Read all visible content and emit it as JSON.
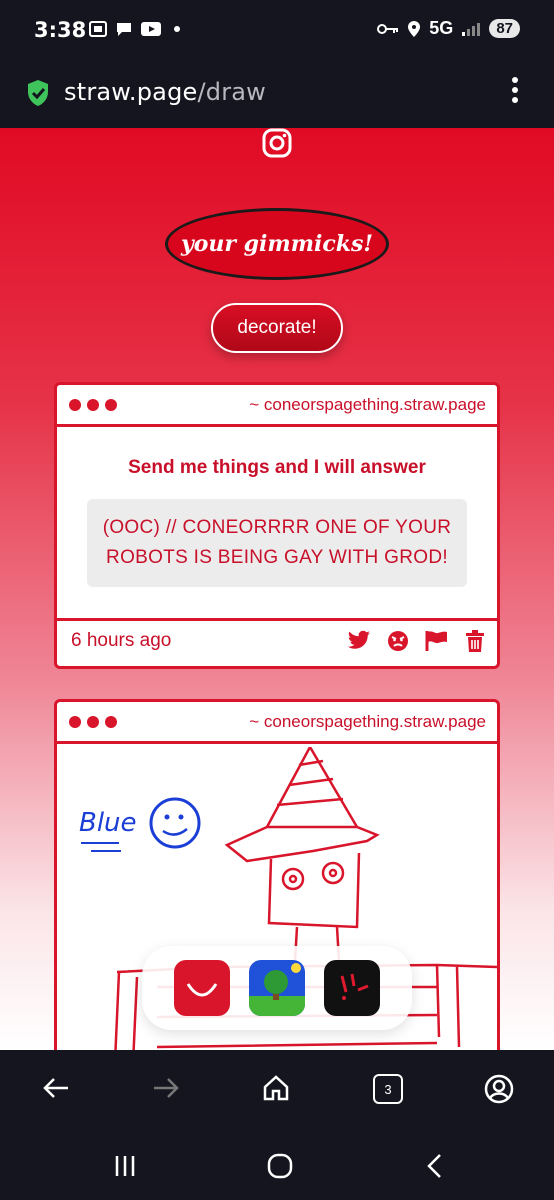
{
  "status_bar": {
    "time": "3:38",
    "network": "5G",
    "battery": "87"
  },
  "url_bar": {
    "host": "straw.page",
    "path": "/draw"
  },
  "page": {
    "gimmick_label": "your gimmicks!",
    "decorate_label": "decorate!"
  },
  "cards": [
    {
      "site": "~ coneorspagething.straw.page",
      "title": "Send me things and I will answer",
      "body": "(OOC) // CONEORRRR ONE OF YOUR ROBOTS IS BEING GAY WITH GROD!",
      "time": "6 hours ago"
    },
    {
      "site": "~ coneorspagething.straw.page",
      "drawing_text": "Blue"
    }
  ],
  "browser_nav": {
    "tab_count": "3"
  },
  "colors": {
    "accent": "#d8152b",
    "status_bg": "#15151f"
  }
}
